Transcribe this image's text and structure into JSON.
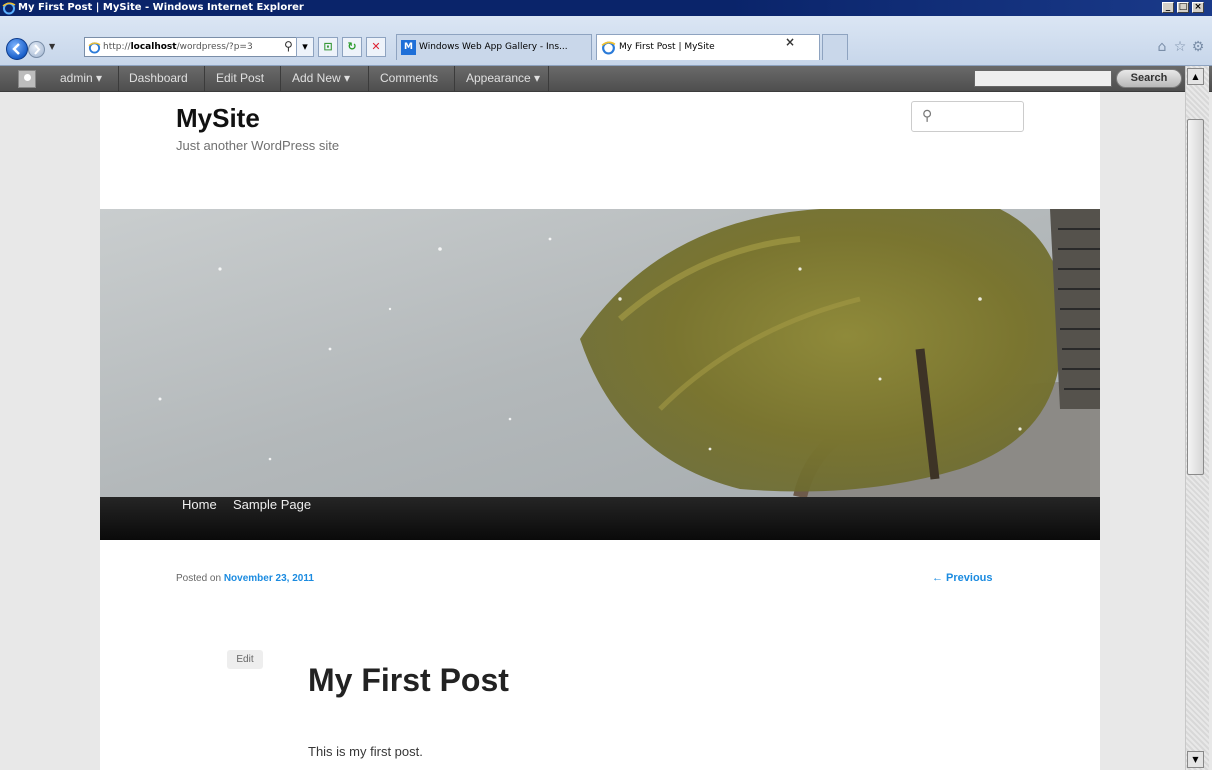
{
  "window": {
    "title": "My First Post | MySite - Windows Internet Explorer"
  },
  "browser": {
    "address_prefix": "http://",
    "address_host": "localhost",
    "address_path": "/wordpress/?p=3",
    "tabs": [
      {
        "label": "Windows Web App Gallery - Ins...",
        "active": false
      },
      {
        "label": "My First Post | MySite",
        "active": true
      }
    ],
    "tab_close_glyph": "×"
  },
  "adminbar": {
    "user": "admin ▾",
    "items": [
      "Dashboard",
      "Edit Post",
      "Add New ▾",
      "Comments",
      "Appearance ▾"
    ],
    "search_button": "Search"
  },
  "site": {
    "title": "MySite",
    "description": "Just another WordPress site",
    "menu": [
      "Home",
      "Sample Page"
    ]
  },
  "post": {
    "posted_on_label": "Posted on",
    "date": "November 23, 2011",
    "previous": "← Previous",
    "edit": "Edit",
    "title": "My First Post",
    "body": "This is my first post."
  },
  "colors": {
    "link_blue": "#1b8be0",
    "adminbar_bg": "#565656",
    "titlebar": "#0a246a"
  }
}
